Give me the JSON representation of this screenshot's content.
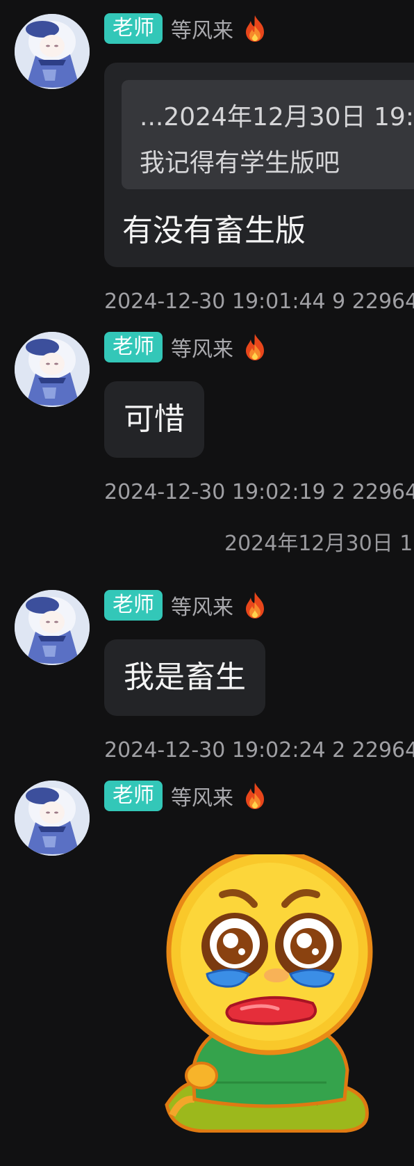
{
  "messages": [
    {
      "role_badge": "老师",
      "sender_name": "等风来",
      "quote_header": "...2024年12月30日 19:",
      "quote_text": "我记得有学生版吧",
      "text": "有没有畜生版",
      "meta": "2024-12-30 19:01:44 9 22964"
    },
    {
      "role_badge": "老师",
      "sender_name": "等风来",
      "text": "可惜",
      "meta": "2024-12-30 19:02:19 2 22964"
    },
    {
      "role_badge": "老师",
      "sender_name": "等风来",
      "text": "我是畜生",
      "meta": "2024-12-30 19:02:24 2 22964"
    },
    {
      "role_badge": "老师",
      "sender_name": "等风来",
      "sticker": "crying-kneeling-emoji-sticker"
    }
  ],
  "divider_time": "2024年12月30日 1",
  "colors": {
    "background": "#111112",
    "bubble": "#232427",
    "quote_bg": "#36373b",
    "badge": "#33c7b8",
    "name": "#a9a9ad",
    "meta": "#a0a0a4"
  },
  "icons": [
    "fire-icon",
    "avatar"
  ]
}
